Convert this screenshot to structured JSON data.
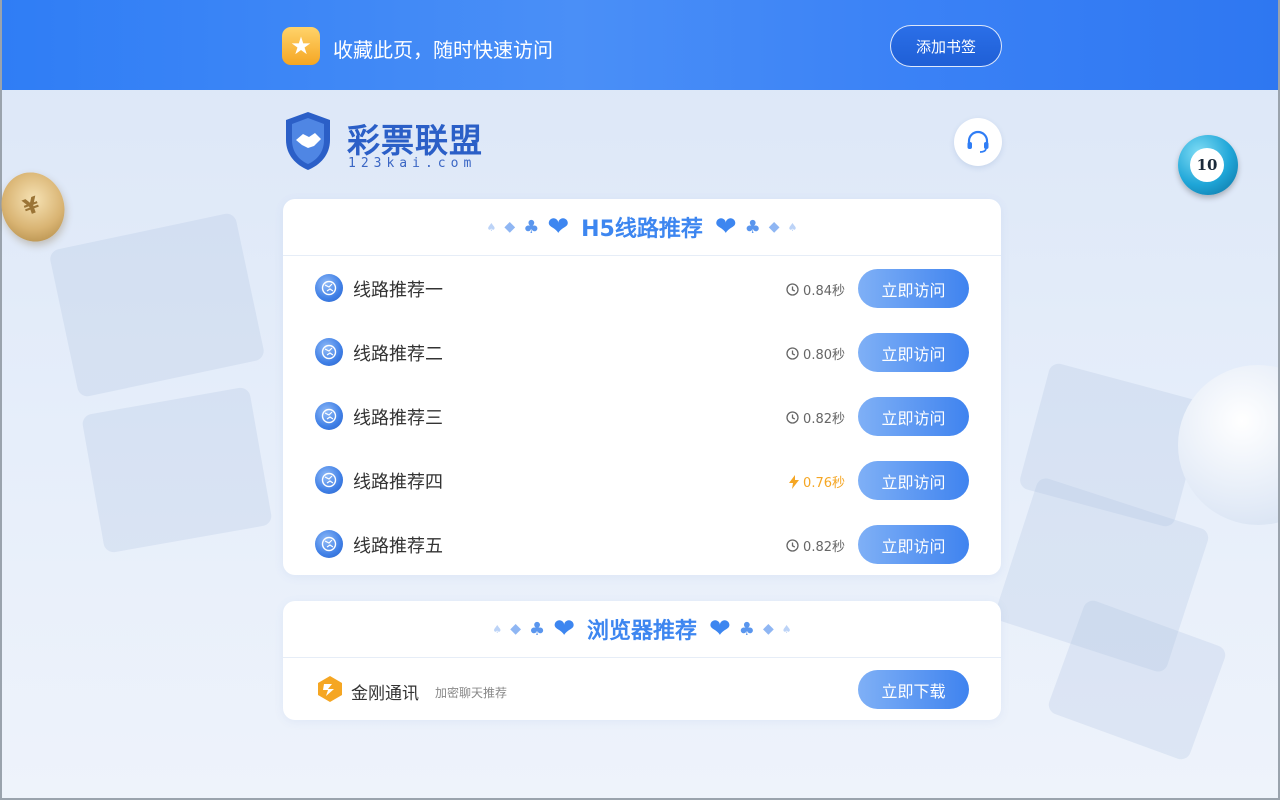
{
  "banner": {
    "tip": "收藏此页，随时快速访问",
    "bookmark_button": "添加书签",
    "star_icon": "star-icon",
    "accent": "#2f7df5"
  },
  "brand": {
    "name": "彩票联盟",
    "domain": "123kai.com",
    "logo_icon": "handshake-shield-icon"
  },
  "support": {
    "icon": "headset-icon"
  },
  "decor": {
    "lottery_ball_number": "10",
    "coin_symbol": "¥"
  },
  "routes_panel": {
    "title": "H5线路推荐",
    "items": [
      {
        "label": "线路推荐一",
        "speed": "0.84秒",
        "fast": false,
        "button": "立即访问"
      },
      {
        "label": "线路推荐二",
        "speed": "0.80秒",
        "fast": false,
        "button": "立即访问"
      },
      {
        "label": "线路推荐三",
        "speed": "0.82秒",
        "fast": false,
        "button": "立即访问"
      },
      {
        "label": "线路推荐四",
        "speed": "0.76秒",
        "fast": true,
        "button": "立即访问"
      },
      {
        "label": "线路推荐五",
        "speed": "0.82秒",
        "fast": false,
        "button": "立即访问"
      }
    ]
  },
  "browser_panel": {
    "title": "浏览器推荐",
    "app": {
      "name": "金刚通讯",
      "description": "加密聊天推荐",
      "button": "立即下载",
      "icon": "jingang-app-icon"
    }
  },
  "colors": {
    "title_blue": "#3d86f0",
    "fast_speed": "#f5a623",
    "button_gradient_start": "#7fb0f6",
    "button_gradient_end": "#3f83ef"
  }
}
